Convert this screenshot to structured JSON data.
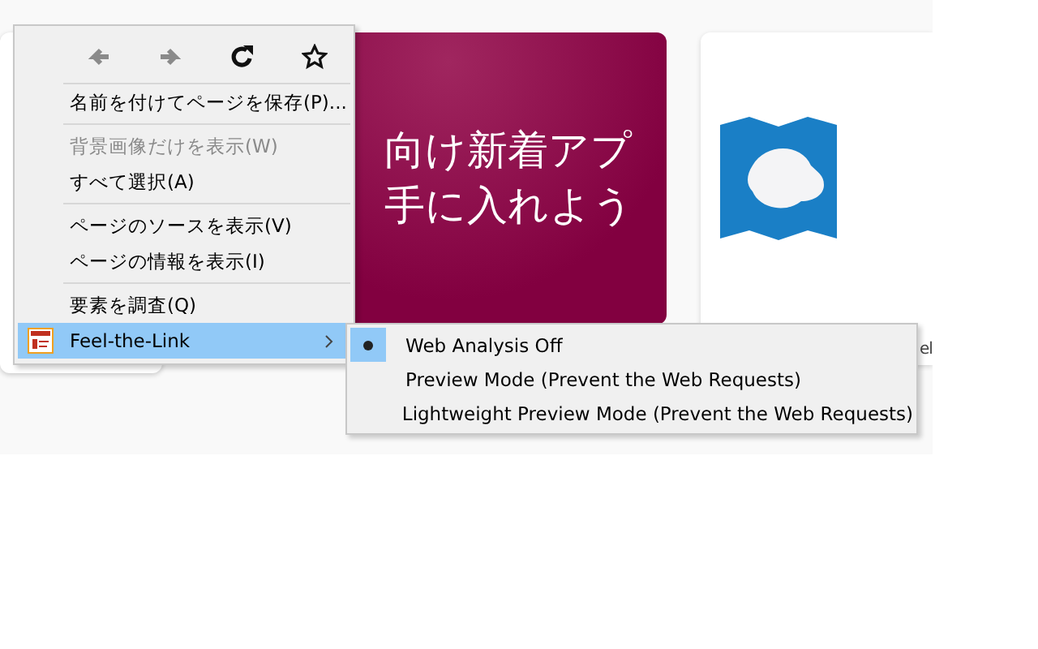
{
  "page": {
    "tiles": [
      {
        "kind": "partial"
      },
      {
        "kind": "promo",
        "lines": [
          "向け新着アプ",
          "手に入れよう"
        ]
      },
      {
        "kind": "logo",
        "label": "el"
      }
    ]
  },
  "context_menu": {
    "nav_buttons": [
      {
        "kind": "back",
        "disabled": true
      },
      {
        "kind": "forward",
        "disabled": true
      },
      {
        "kind": "reload",
        "disabled": false
      },
      {
        "kind": "bookmark",
        "disabled": false
      }
    ],
    "groups": [
      [
        {
          "label": "名前を付けてページを保存(P)...",
          "disabled": false,
          "highlighted": false
        }
      ],
      [
        {
          "label": "背景画像だけを表示(W)",
          "disabled": true,
          "highlighted": false
        },
        {
          "label": "すべて選択(A)",
          "disabled": false,
          "highlighted": false
        }
      ],
      [
        {
          "label": "ページのソースを表示(V)",
          "disabled": false,
          "highlighted": false
        },
        {
          "label": "ページの情報を表示(I)",
          "disabled": false,
          "highlighted": false
        }
      ],
      [
        {
          "label": "要素を調査(Q)",
          "disabled": false,
          "highlighted": false
        },
        {
          "label": "Feel-the-Link",
          "disabled": false,
          "highlighted": true,
          "submenu": true
        }
      ]
    ]
  },
  "submenu": {
    "items": [
      {
        "label": "Web Analysis Off",
        "selected": true
      },
      {
        "label": "Preview Mode (Prevent the Web Requests)",
        "selected": false
      },
      {
        "label": "Lightweight Preview Mode (Prevent the Web Requests)",
        "selected": false
      }
    ]
  }
}
